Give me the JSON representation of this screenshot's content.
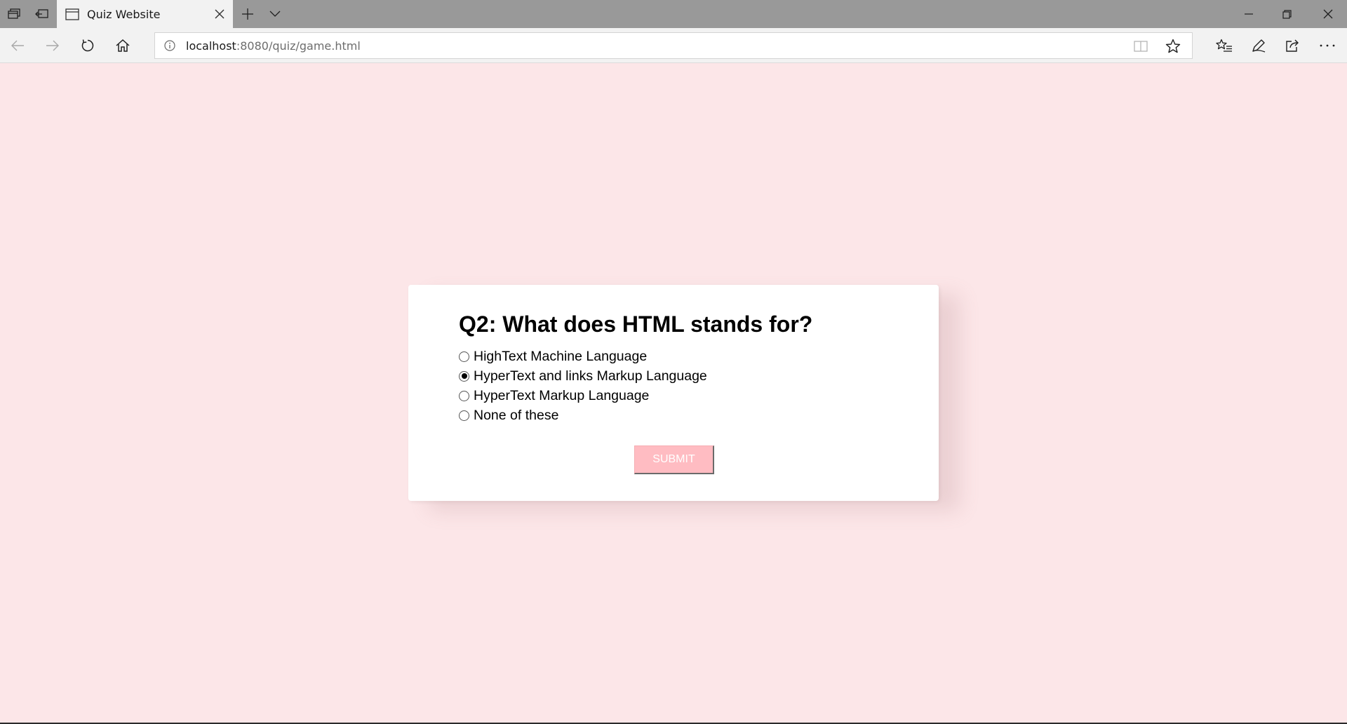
{
  "browser": {
    "tab": {
      "title": "Quiz Website"
    },
    "address": {
      "host": "localhost",
      "rest": ":8080/quiz/game.html"
    }
  },
  "quiz": {
    "question": "Q2: What does HTML stands for?",
    "answers": [
      {
        "label": "HighText Machine Language",
        "selected": false
      },
      {
        "label": "HyperText and links Markup Language",
        "selected": true
      },
      {
        "label": "HyperText Markup Language",
        "selected": false
      },
      {
        "label": "None of these",
        "selected": false
      }
    ],
    "submit_label": "SUBMIT"
  },
  "colors": {
    "page_background": "#fce6e8",
    "submit_button": "#ffbcc2",
    "browser_chrome": "#999999"
  },
  "icons": [
    "tab-preview-icon",
    "set-aside-tabs-icon",
    "page-icon",
    "close-icon",
    "plus-icon",
    "chevron-down-icon",
    "minimize-icon",
    "restore-icon",
    "back-arrow-icon",
    "forward-arrow-icon",
    "refresh-icon",
    "home-icon",
    "info-icon",
    "reading-view-icon",
    "star-icon",
    "favorites-hub-icon",
    "pen-icon",
    "share-icon",
    "more-icon"
  ]
}
